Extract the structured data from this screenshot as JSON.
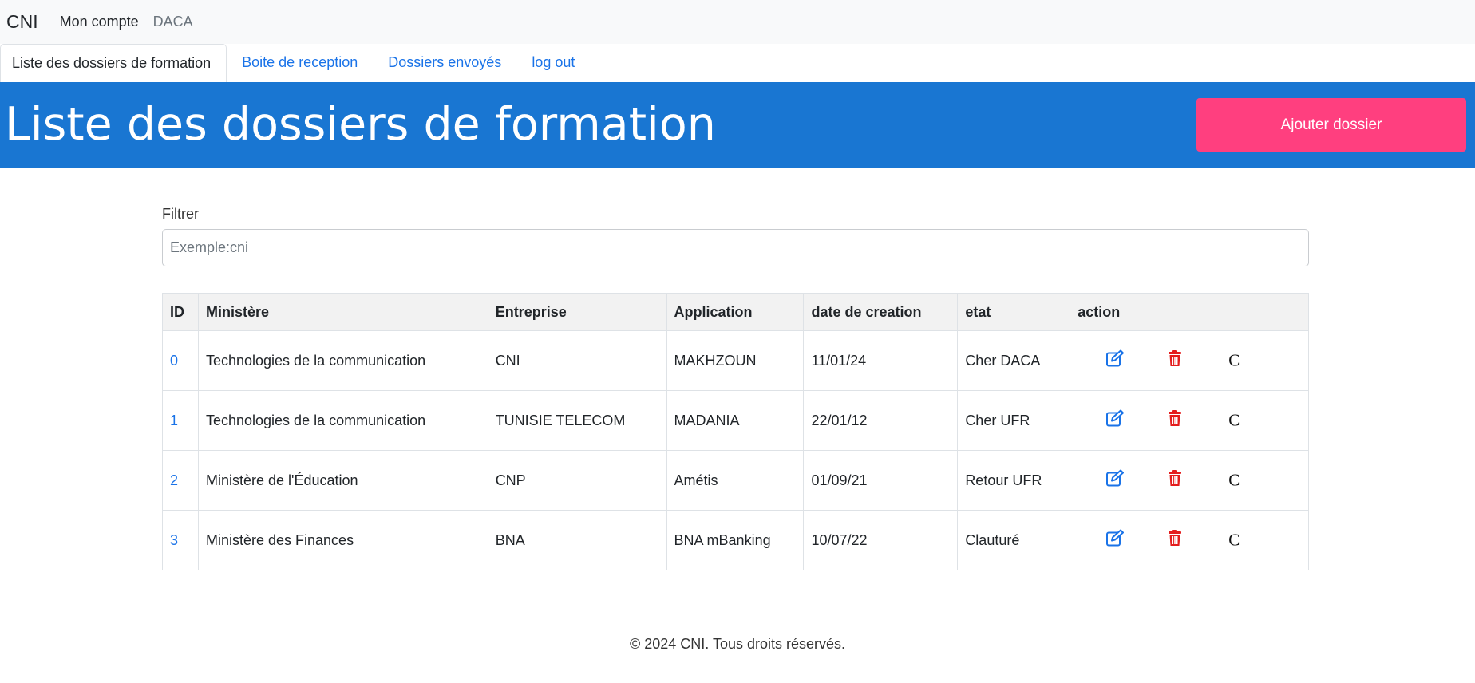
{
  "navbar": {
    "brand": "CNI",
    "links": [
      "Mon compte",
      "DACA"
    ]
  },
  "tabs": [
    {
      "label": "Liste des dossiers de formation",
      "active": true
    },
    {
      "label": "Boite de reception",
      "active": false
    },
    {
      "label": "Dossiers envoyés",
      "active": false
    },
    {
      "label": "log out",
      "active": false
    }
  ],
  "banner": {
    "title": "Liste des dossiers de formation",
    "add_button": "Ajouter dossier",
    "color": "#1976d2",
    "button_color": "#ff3f7f"
  },
  "filter": {
    "label": "Filtrer",
    "placeholder": "Exemple:cni",
    "value": ""
  },
  "table": {
    "headers": [
      "ID",
      "Ministère",
      "Entreprise",
      "Application",
      "date de creation",
      "etat",
      "action"
    ],
    "rows": [
      {
        "id": "0",
        "ministere": "Technologies de la communication",
        "entreprise": "CNI",
        "application": "MAKHZOUN",
        "date": "11/01/24",
        "etat": "Cher DACA"
      },
      {
        "id": "1",
        "ministere": "Technologies de la communication",
        "entreprise": "TUNISIE TELECOM",
        "application": "MADANIA",
        "date": "22/01/12",
        "etat": "Cher UFR"
      },
      {
        "id": "2",
        "ministere": "Ministère de l'Éducation",
        "entreprise": "CNP",
        "application": "Amétis",
        "date": "01/09/21",
        "etat": "Retour UFR"
      },
      {
        "id": "3",
        "ministere": "Ministère des Finances",
        "entreprise": "BNA",
        "application": "BNA mBanking",
        "date": "10/07/22",
        "etat": "Clauturé"
      }
    ],
    "action_icons": [
      "edit-icon",
      "trash-icon",
      "c-glyph"
    ],
    "action_c_glyph": "C"
  },
  "footer": {
    "text": "© 2024 CNI. Tous droits réservés."
  }
}
